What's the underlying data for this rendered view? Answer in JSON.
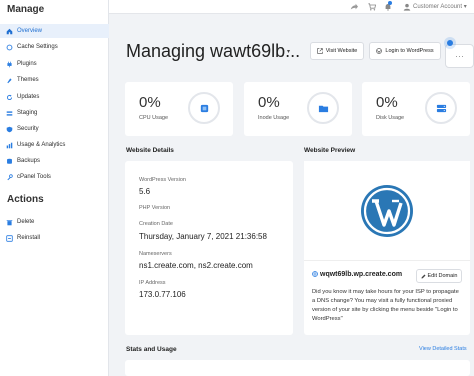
{
  "sidebar": {
    "manage_heading": "Manage",
    "actions_heading": "Actions",
    "items": [
      {
        "label": "Overview",
        "icon": "home-icon"
      },
      {
        "label": "Cache Settings",
        "icon": "cache-icon"
      },
      {
        "label": "Plugins",
        "icon": "plug-icon"
      },
      {
        "label": "Themes",
        "icon": "paintbrush-icon"
      },
      {
        "label": "Updates",
        "icon": "refresh-icon"
      },
      {
        "label": "Staging",
        "icon": "staging-icon"
      },
      {
        "label": "Security",
        "icon": "shield-icon"
      },
      {
        "label": "Usage & Analytics",
        "icon": "chart-icon"
      },
      {
        "label": "Backups",
        "icon": "backup-icon"
      },
      {
        "label": "cPanel Tools",
        "icon": "tools-icon"
      }
    ],
    "actions": [
      {
        "label": "Delete",
        "icon": "trash-icon"
      },
      {
        "label": "Reinstall",
        "icon": "reinstall-icon"
      }
    ]
  },
  "topbar": {
    "account_label": "Customer Account",
    "account_caret": "▾",
    "icons": [
      "share-icon",
      "cart-icon",
      "bell-icon",
      "user-icon"
    ]
  },
  "header": {
    "title": "Managing wawt69lb...",
    "caret": "▾",
    "visit_button": "Visit Website",
    "login_button": "Login to WordPress",
    "more_button": "⋯"
  },
  "stats": [
    {
      "value": "0%",
      "label": "CPU Usage",
      "icon": "cpu-icon",
      "color": "#2a7de1"
    },
    {
      "value": "0%",
      "label": "Inode Usage",
      "icon": "folder-icon",
      "color": "#2a7de1"
    },
    {
      "value": "0%",
      "label": "Disk Usage",
      "icon": "disk-icon",
      "color": "#2a7de1"
    }
  ],
  "details": {
    "heading": "Website Details",
    "wp_version_label": "WordPress Version",
    "wp_version": "5.6",
    "php_label": "PHP Version",
    "creation_label": "Creation Date",
    "creation_date": "Thursday, January 7, 2021 21:36:58",
    "ns_label": "Nameservers",
    "nameservers": "ns1.create.com, ns2.create.com",
    "ip_label": "IP Address",
    "ip": "173.0.77.106"
  },
  "preview": {
    "heading": "Website Preview",
    "domain": "wqwt69lb.wp.create.com",
    "edit_button": "Edit Domain",
    "description": "Did you know it may take hours for your ISP to propagate a DNS change? You may visit a fully functional proxied version of your site by clicking the menu beside \"Login to WordPress\""
  },
  "stats_usage": {
    "heading": "Stats and Usage",
    "link": "View Detailed Stats"
  },
  "colors": {
    "accent": "#2a7de1",
    "wp_blue": "#2a77b5"
  }
}
